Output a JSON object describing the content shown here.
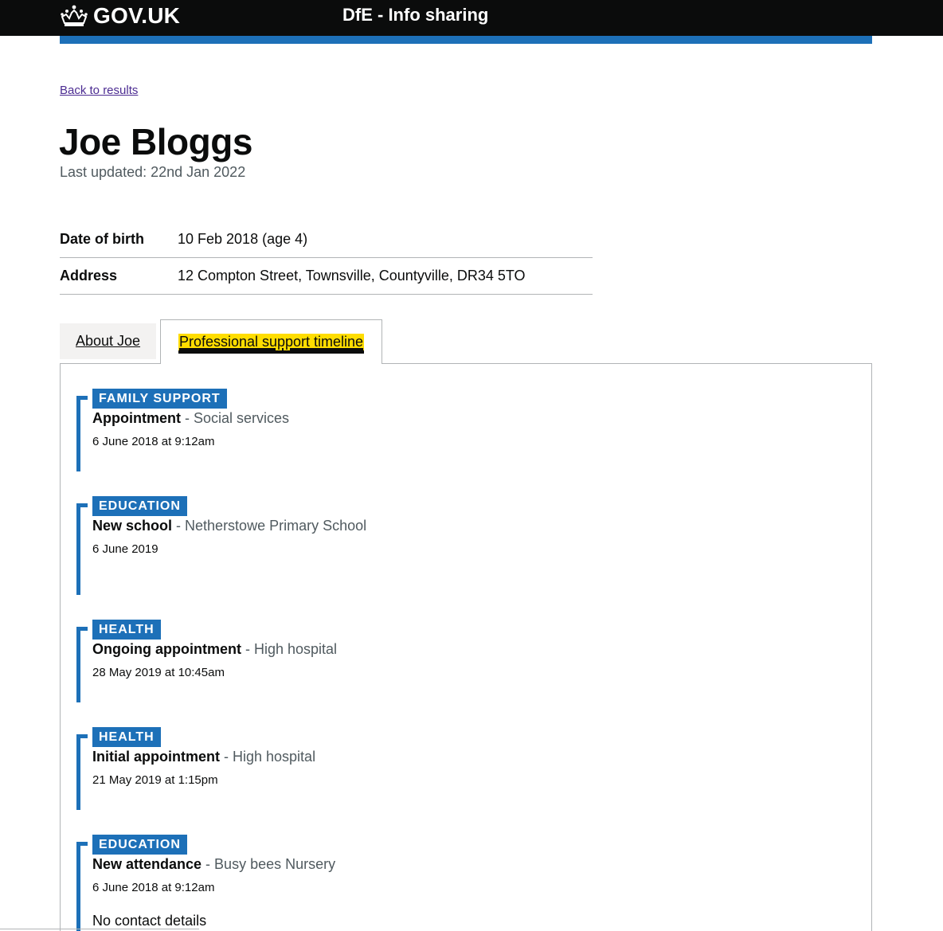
{
  "header": {
    "logo_text": "GOV.UK",
    "service_name": "DfE - Info sharing"
  },
  "back_link": "Back to results",
  "title": "Joe Bloggs",
  "last_updated": "Last updated: 22nd Jan 2022",
  "summary": [
    {
      "key": "Date of birth",
      "value": "10 Feb 2018 (age 4)"
    },
    {
      "key": "Address",
      "value": "12 Compton Street, Townsville, Countyville, DR34 5TO"
    }
  ],
  "tabs": [
    {
      "label": "About Joe",
      "selected": false
    },
    {
      "label": "Professional support timeline",
      "selected": true
    }
  ],
  "timeline": [
    {
      "tag": "FAMILY SUPPORT",
      "title": "Appointment",
      "sep": " - ",
      "provider": "Social services",
      "date": "6 June 2018 at 9:12am",
      "extra": ""
    },
    {
      "tag": "EDUCATION",
      "title": "New school",
      "sep": " - ",
      "provider": "Netherstowe Primary School",
      "date": "6 June 2019",
      "extra": ""
    },
    {
      "tag": "HEALTH",
      "title": "Ongoing appointment",
      "sep": " - ",
      "provider": "High hospital",
      "date": "28 May 2019 at 10:45am",
      "extra": ""
    },
    {
      "tag": "HEALTH",
      "title": "Initial appointment",
      "sep": " - ",
      "provider": "High hospital",
      "date": "21 May 2019 at 1:15pm",
      "extra": ""
    },
    {
      "tag": "EDUCATION",
      "title": "New attendance",
      "sep": " - ",
      "provider": "Busy bees Nursery",
      "date": "6 June 2018 at 9:12am",
      "extra": "No contact details"
    }
  ],
  "colors": {
    "header_bg": "#0b0c0c",
    "brand_blue": "#1d70b8",
    "focus_yellow": "#ffdd00",
    "link_visited": "#4c2c92",
    "secondary_text": "#505a5f"
  },
  "icons": {
    "logo": "crown-icon"
  }
}
